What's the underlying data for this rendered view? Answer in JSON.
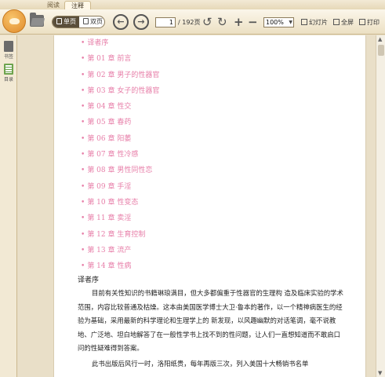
{
  "tabs": [
    {
      "label": "阅读"
    },
    {
      "label": "注释"
    }
  ],
  "toolbar": {
    "view_single": "单页",
    "view_double": "双页",
    "page_current": "1",
    "page_total": "/ 192页",
    "zoom": "100%",
    "slideshow": "幻灯片",
    "fullscreen": "全屏",
    "print": "打印",
    "icons": {
      "prev": "arrow-left-icon",
      "next": "arrow-right-icon",
      "rotate_left": "rotate-left-icon",
      "rotate_right": "rotate-right-icon",
      "zoom_in": "plus-icon",
      "zoom_out": "minus-icon"
    }
  },
  "sidebar": {
    "items": [
      {
        "label": "书签"
      },
      {
        "label": "目录"
      }
    ]
  },
  "toc": [
    {
      "label": "译者序"
    },
    {
      "label": "第 01 章  前言"
    },
    {
      "label": "第 02 章  男子的性器官"
    },
    {
      "label": "第 03 章  女子的性器官"
    },
    {
      "label": "第 04 章  性交"
    },
    {
      "label": "第 05 章  春药"
    },
    {
      "label": "第 06 章  阳萎"
    },
    {
      "label": "第 07 章  性冷感"
    },
    {
      "label": "第 08 章  男性同性恋"
    },
    {
      "label": "第 09 章  手淫"
    },
    {
      "label": "第 10 章  性变态"
    },
    {
      "label": "第 11 章  卖淫"
    },
    {
      "label": "第 12 章  生育控制"
    },
    {
      "label": "第 13 章  流产"
    },
    {
      "label": "第 14 章  性病"
    }
  ],
  "document": {
    "section_title": "译者序",
    "paragraph1": "目前有关性知识的书籍琳琅满目，但大多都偏重于性器官的生理构 造及临床实验的学术范围，内容比较普通及枯燥。这本由美国医学博士大卫·鲁本的著作，以一个精神病医生的经验为基础，采用最新的科学理论和生理学上的 新发现，以风趣幽默的对话笔调，毫不说教地、广泛地、坦白地解答了在一般性学书上找不到的性问题，让人们一直想知道而不敢启口问的性疑难得到答案。",
    "paragraph2": "此书出版后风行一时，洛阳纸贵，每年再版三次，列入美国十大畅销书名单"
  }
}
